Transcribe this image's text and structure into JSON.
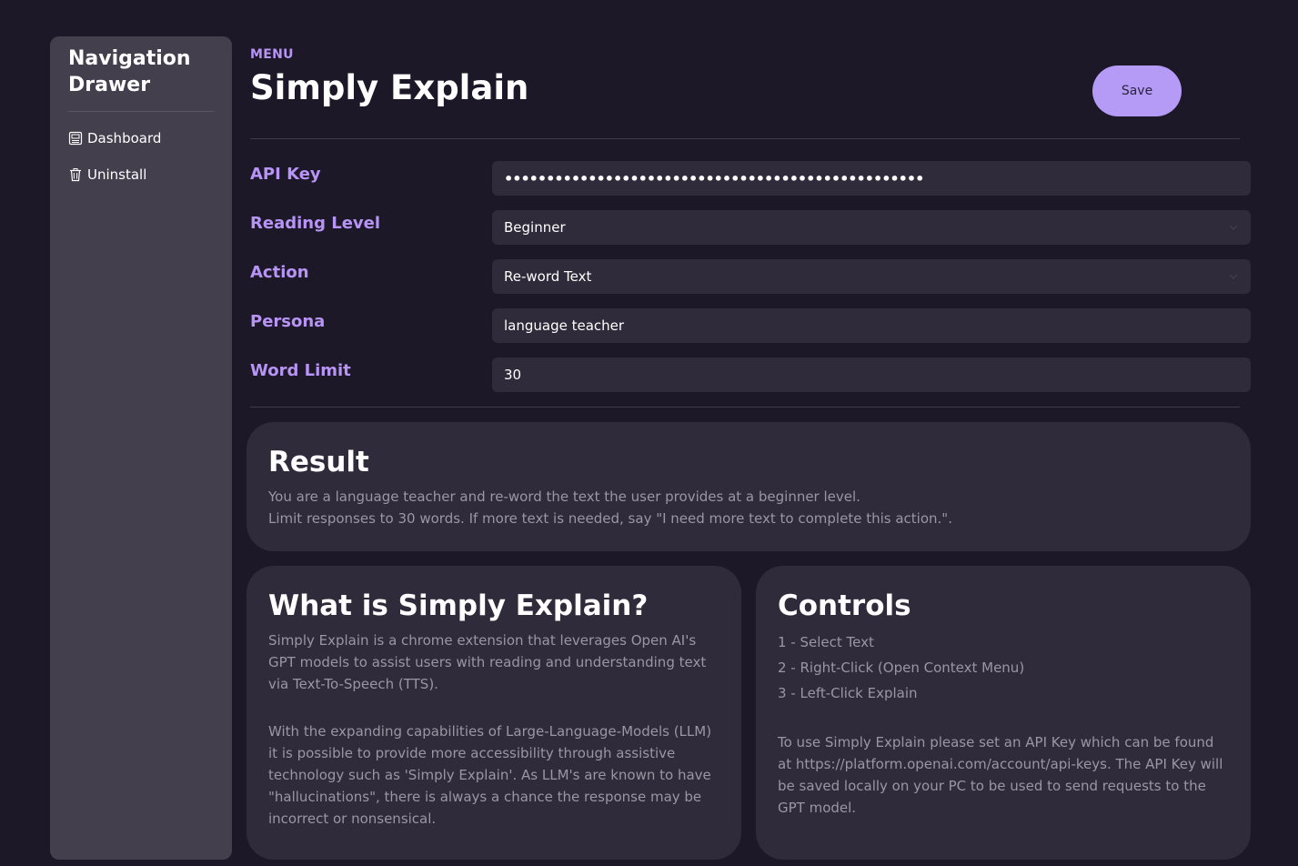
{
  "drawer": {
    "title": "Navigation Drawer",
    "items": [
      {
        "label": "Dashboard",
        "icon": "dashboard-icon"
      },
      {
        "label": "Uninstall",
        "icon": "trash-icon"
      }
    ]
  },
  "header": {
    "menu_label": "MENU",
    "title": "Simply Explain",
    "save_label": "Save"
  },
  "form": {
    "api_key": {
      "label": "API Key",
      "value": "••••••••••••••••••••••••••••••••••••••••••••••••••"
    },
    "reading_level": {
      "label": "Reading Level",
      "value": "Beginner"
    },
    "action": {
      "label": "Action",
      "value": "Re-word Text"
    },
    "persona": {
      "label": "Persona",
      "value": "language teacher"
    },
    "word_limit": {
      "label": "Word Limit",
      "value": "30"
    }
  },
  "result": {
    "title": "Result",
    "line1": "You are a language teacher and re-word the text the user provides at a beginner level.",
    "line2": "Limit responses to 30 words. If more text is needed, say \"I need more text to complete this action.\"."
  },
  "about": {
    "title": "What is Simply Explain?",
    "para1": "Simply Explain is a chrome extension that leverages Open AI's GPT models to assist users with reading and understanding text via Text-To-Speech (TTS).",
    "para2": "With the expanding capabilities of Large-Language-Models (LLM) it is possible to provide more accessibility through assistive technology such as 'Simply Explain'. As LLM's are known to have \"hallucinations\", there is always a chance the response may be incorrect or nonsensical."
  },
  "controls": {
    "title": "Controls",
    "steps": [
      "1 - Select Text",
      "2 - Right-Click (Open Context Menu)",
      "3 - Left-Click Explain"
    ],
    "note": "To use Simply Explain please set an API Key which can be found at https://platform.openai.com/account/api-keys. The API Key will be saved locally on your PC to be used to send requests to the GPT model."
  },
  "colors": {
    "background": "#1c1827",
    "drawer": "#433f4d",
    "card": "#2f2b3a",
    "accent": "#b794f6",
    "button": "#b69bf6"
  }
}
